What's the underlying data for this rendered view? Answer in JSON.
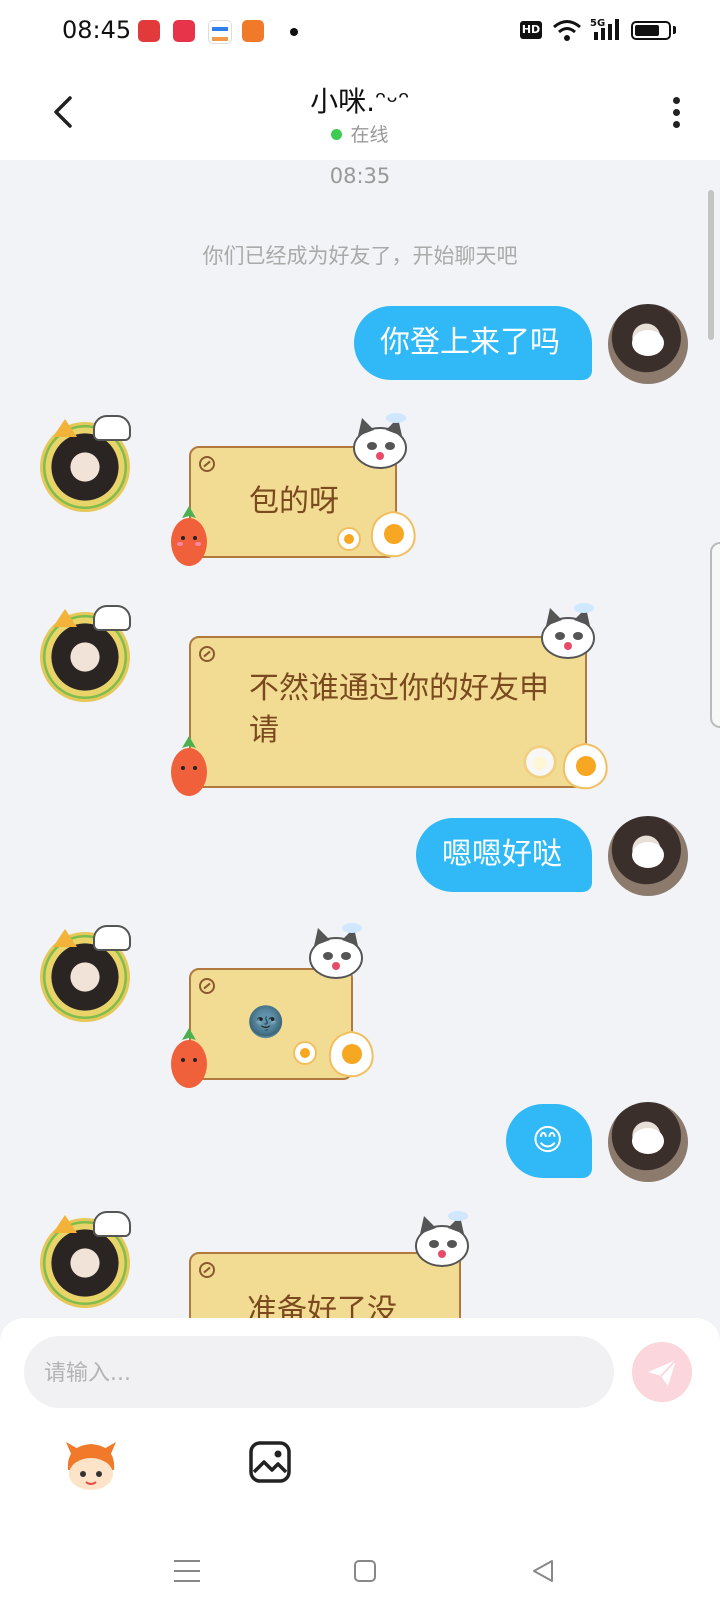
{
  "status_bar": {
    "time": "08:45",
    "hd": "HD",
    "network": "5G",
    "battery_level": 0.75,
    "app_icons": [
      "video-app-icon",
      "photo-app-icon",
      "wallet-app-icon",
      "reader-app-icon"
    ]
  },
  "header": {
    "title": "小咪.ᵔᵕᵔ",
    "presence": "在线",
    "presence_color": "#3ccc52"
  },
  "chat": {
    "timestamp": "08:35",
    "system_message": "你们已经成为好友了，开始聊天吧",
    "messages": [
      {
        "from": "me",
        "text": "你登上来了吗"
      },
      {
        "from": "them",
        "text": "包的呀"
      },
      {
        "from": "them",
        "text": "不然谁通过你的好友申请"
      },
      {
        "from": "me",
        "text": "嗯嗯好哒"
      },
      {
        "from": "them",
        "text": "🌚"
      },
      {
        "from": "me",
        "text": "😊"
      },
      {
        "from": "them",
        "text": "准备好了没"
      }
    ]
  },
  "composer": {
    "placeholder": "请输入...",
    "send_icon": "send-icon",
    "tools": [
      "emoji-icon",
      "image-icon"
    ]
  },
  "nav": {
    "items": [
      "menu-icon",
      "home-icon",
      "back-icon"
    ]
  },
  "colors": {
    "my_bubble": "#30b9f6",
    "their_bubble": "#f2dc94",
    "their_text": "#7a4a1e",
    "background": "#f2f3f7"
  }
}
